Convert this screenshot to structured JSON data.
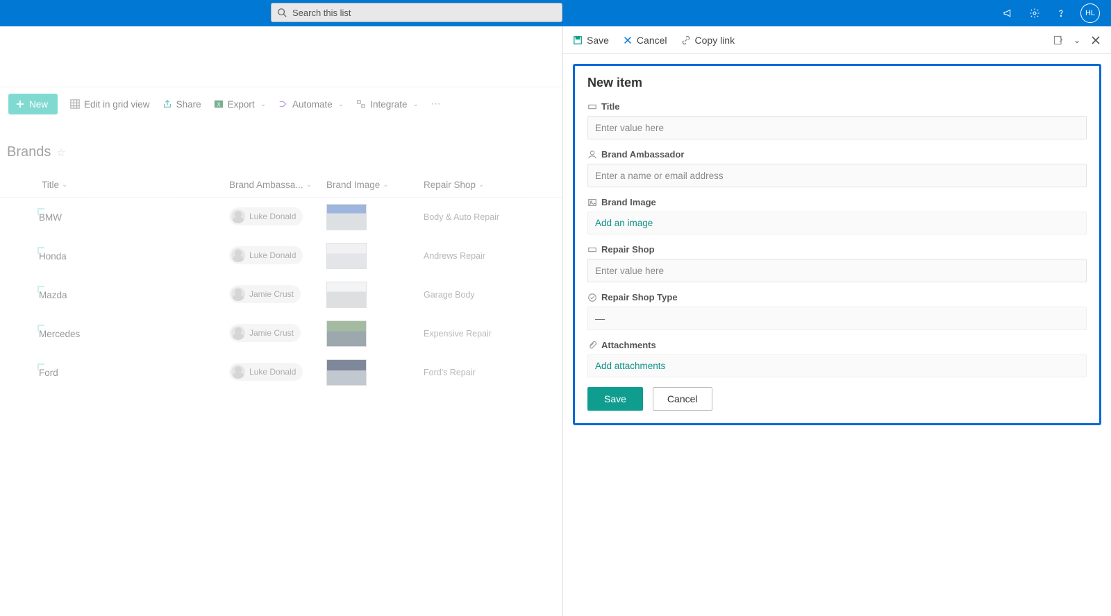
{
  "suite": {
    "search_placeholder": "Search this list",
    "avatar_initials": "HL"
  },
  "commands": {
    "new_label": "New",
    "edit_grid": "Edit in grid view",
    "share": "Share",
    "export": "Export",
    "automate": "Automate",
    "integrate": "Integrate"
  },
  "list": {
    "title": "Brands",
    "columns": {
      "title": "Title",
      "ambassador": "Brand Ambassa...",
      "image": "Brand Image",
      "shop": "Repair Shop"
    },
    "rows": [
      {
        "title": "BMW",
        "ambassador": "Luke Donald",
        "shop": "Body & Auto Repair"
      },
      {
        "title": "Honda",
        "ambassador": "Luke Donald",
        "shop": "Andrews Repair"
      },
      {
        "title": "Mazda",
        "ambassador": "Jamie Crust",
        "shop": "Garage Body"
      },
      {
        "title": "Mercedes",
        "ambassador": "Jamie Crust",
        "shop": "Expensive Repair"
      },
      {
        "title": "Ford",
        "ambassador": "Luke Donald",
        "shop": "Ford's Repair"
      }
    ]
  },
  "panel": {
    "top": {
      "save": "Save",
      "cancel": "Cancel",
      "copy_link": "Copy link"
    },
    "heading": "New item",
    "fields": {
      "title_label": "Title",
      "title_placeholder": "Enter value here",
      "ambassador_label": "Brand Ambassador",
      "ambassador_placeholder": "Enter a name or email address",
      "image_label": "Brand Image",
      "image_action": "Add an image",
      "shop_label": "Repair Shop",
      "shop_placeholder": "Enter value here",
      "shop_type_label": "Repair Shop Type",
      "shop_type_value": "—",
      "attachments_label": "Attachments",
      "attachments_action": "Add attachments"
    },
    "buttons": {
      "save": "Save",
      "cancel": "Cancel"
    }
  }
}
